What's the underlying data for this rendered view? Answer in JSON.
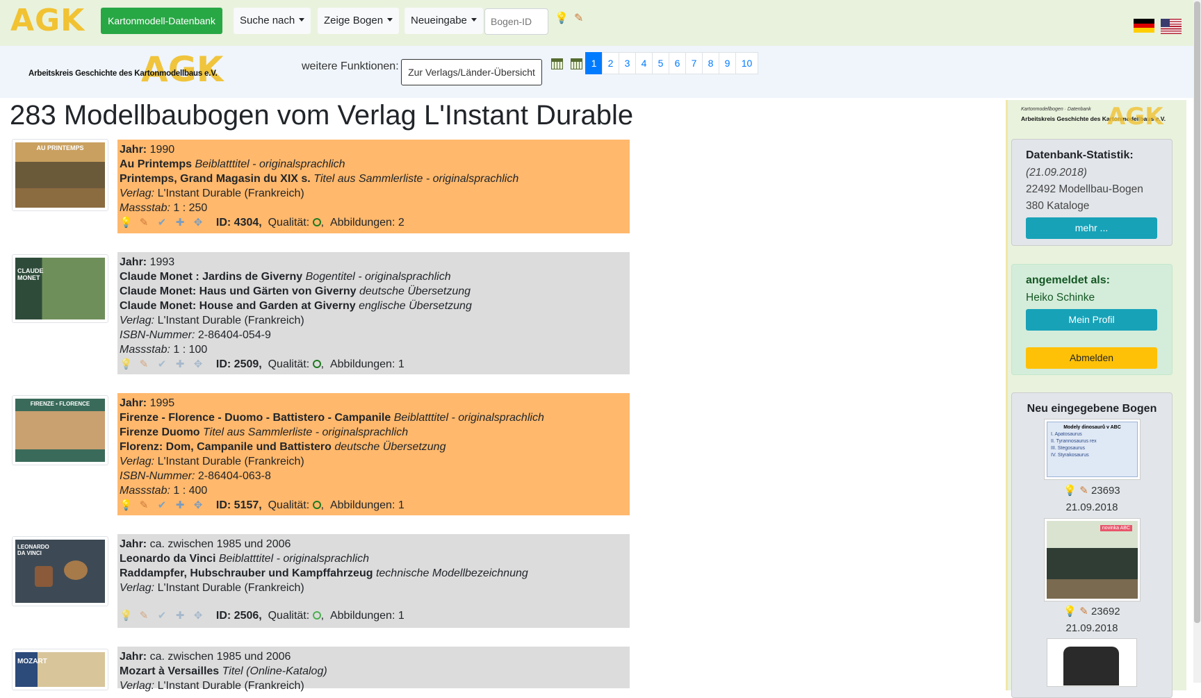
{
  "nav": {
    "logo": "AGK",
    "brand_button": "Kartonmodell-Datenbank",
    "search_label": "Suche nach",
    "show_label": "Zeige Bogen",
    "new_label": "Neueingabe",
    "id_placeholder": "Bogen-ID"
  },
  "header": {
    "logo_text": "Arbeitskreis Geschichte des Kartonmodellbaus e.V.",
    "logo_agk": "AGK",
    "more_functions": "weitere Funktionen:",
    "overview_button": "Zur Verlags/Länder-Übersicht",
    "pages": [
      "1",
      "2",
      "3",
      "4",
      "5",
      "6",
      "7",
      "8",
      "9",
      "10"
    ],
    "active_page": "1"
  },
  "main": {
    "title": "283 Modellbaubogen vom Verlag L'Instant Durable",
    "entries": [
      {
        "year_label": "Jahr:",
        "year": "1990",
        "titles": [
          {
            "name": "Au Printemps",
            "note": "Beiblatttitel - originalsprachlich"
          },
          {
            "name": "Printemps, Grand Magasin du XIX s.",
            "note": "Titel aus Sammlerliste - originalsprachlich"
          }
        ],
        "verlag_label": "Verlag:",
        "verlag": "L'Instant Durable (Frankreich)",
        "isbn_label": "",
        "isbn": "",
        "massstab_label": "Massstab:",
        "massstab": "1 : 250",
        "id_text": "ID: 4304,",
        "qualitaet": "Qualität:",
        "abbildungen": "Abbildungen: 2",
        "thumb_text": "AU PRINTEMPS"
      },
      {
        "year_label": "Jahr:",
        "year": "1993",
        "titles": [
          {
            "name": "Claude Monet : Jardins de Giverny",
            "note": "Bogentitel - originalsprachlich"
          },
          {
            "name": "Claude Monet: Haus und Gärten von Giverny",
            "note": "deutsche Übersetzung"
          },
          {
            "name": "Claude Monet: House and Garden at Giverny",
            "note": "englische Übersetzung"
          }
        ],
        "verlag_label": "Verlag:",
        "verlag": "L'Instant Durable (Frankreich)",
        "isbn_label": "ISBN-Nummer:",
        "isbn": "2-86404-054-9",
        "massstab_label": "Massstab:",
        "massstab": "1 : 100",
        "id_text": "ID: 2509,",
        "qualitaet": "Qualität:",
        "abbildungen": "Abbildungen: 1",
        "thumb_text": "CLAUDE MONET"
      },
      {
        "year_label": "Jahr:",
        "year": "1995",
        "titles": [
          {
            "name": "Firenze - Florence - Duomo - Battistero - Campanile",
            "note": "Beiblatttitel - originalsprachlich"
          },
          {
            "name": "Firenze Duomo",
            "note": "Titel aus Sammlerliste - originalsprachlich"
          },
          {
            "name": "Florenz: Dom, Campanile und Battistero",
            "note": "deutsche Übersetzung"
          }
        ],
        "verlag_label": "Verlag:",
        "verlag": "L'Instant Durable (Frankreich)",
        "isbn_label": "ISBN-Nummer:",
        "isbn": "2-86404-063-8",
        "massstab_label": "Massstab:",
        "massstab": "1 : 400",
        "id_text": "ID: 5157,",
        "qualitaet": "Qualität:",
        "abbildungen": "Abbildungen: 1",
        "thumb_text": "FIRENZE ▪ FLORENCE"
      },
      {
        "year_label": "Jahr:",
        "year": "ca. zwischen 1985 und 2006",
        "titles": [
          {
            "name": "Leonardo da Vinci",
            "note": "Beiblatttitel - originalsprachlich"
          },
          {
            "name": "Raddampfer, Hubschrauber und Kampffahrzeug",
            "note": "technische Modellbezeichnung"
          }
        ],
        "verlag_label": "Verlag:",
        "verlag": "L'Instant Durable (Frankreich)",
        "isbn_label": "",
        "isbn": "",
        "massstab_label": "",
        "massstab": "",
        "id_text": "ID: 2506,",
        "qualitaet": "Qualität:",
        "abbildungen": "Abbildungen: 1",
        "thumb_text": "LEONARDO DA VINCI"
      },
      {
        "year_label": "Jahr:",
        "year": "ca. zwischen 1985 und 2006",
        "titles": [
          {
            "name": "Mozart à Versailles",
            "note": "Titel (Online-Katalog)"
          }
        ],
        "verlag_label": "Verlag:",
        "verlag": "L'Instant Durable (Frankreich)",
        "thumb_text": "MOZART"
      }
    ]
  },
  "sidebar": {
    "logo_small": "Kartonmodellbogen · Datenbank",
    "logo_line": "Arbeitskreis Geschichte des Kartonmodellbaus e.V.",
    "logo_agk": "AGK",
    "stats_title": "Datenbank-Statistik:",
    "stats_date": "(21.09.2018)",
    "stats_sheets": "22492 Modellbau-Bogen",
    "stats_catalogs": "380 Kataloge",
    "more_button": "mehr ...",
    "login_title": "angemeldet als:",
    "login_user": "Heiko Schinke",
    "profile_button": "Mein Profil",
    "logout_button": "Abmelden",
    "new_title": "Neu eingegebene Bogen",
    "new_items": [
      {
        "id": "23693",
        "date": "21.09.2018",
        "thumb_title": "Modely dinosaurů v ABC",
        "thumb_lines": [
          "I.   Apatosaurus",
          "II.  Tyrannosaurus rex",
          "III. Stegosaurus",
          "IV.  Styrakosaurus"
        ]
      },
      {
        "id": "23692",
        "date": "21.09.2018",
        "thumb_title": "novinka ABC"
      }
    ]
  },
  "colors": {
    "navbar": "#e9f2dd",
    "accent_green": "#28a745",
    "orange_row": "#ffb86c",
    "grey_row": "#dcdcdc",
    "teal": "#17a2b8",
    "yellow": "#ffc107",
    "logo": "#f1c232"
  }
}
